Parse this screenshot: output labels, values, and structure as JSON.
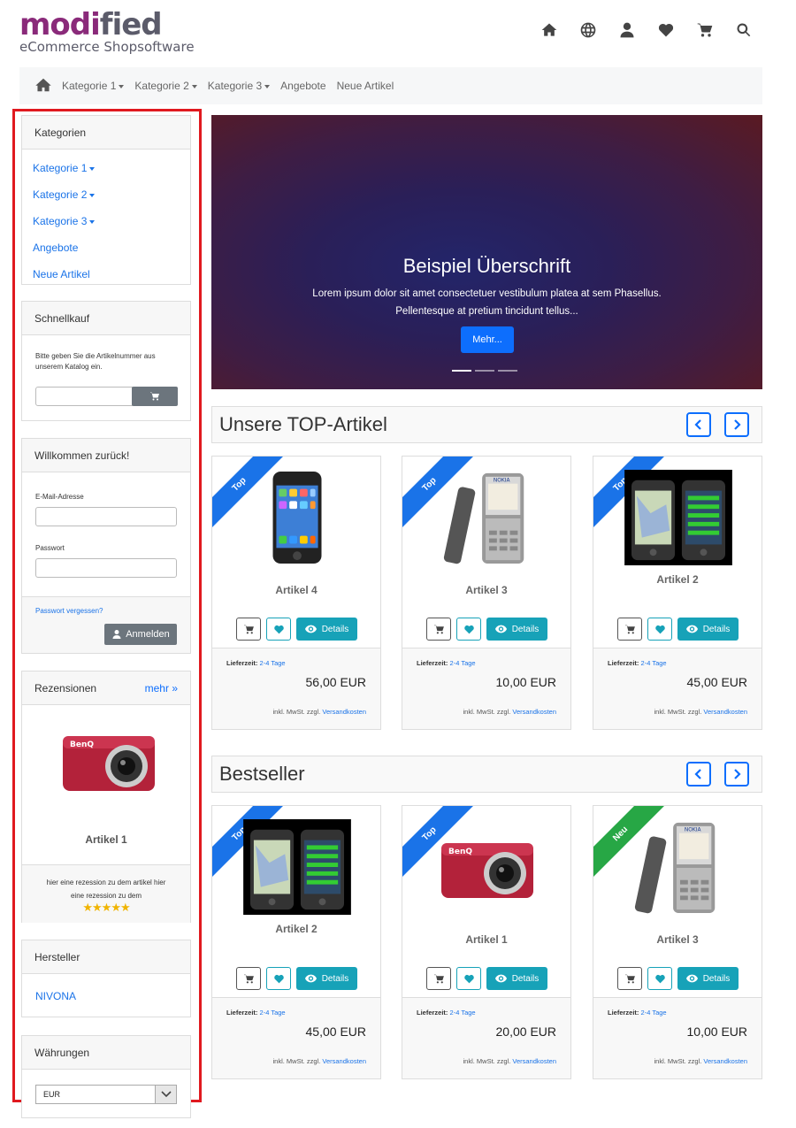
{
  "header": {
    "logo_main_1": "modi",
    "logo_main_2": "fied",
    "logo_sub": "eCommerce Shopsoftware",
    "icons": [
      "home-icon",
      "globe-icon",
      "user-icon",
      "heart-icon",
      "cart-icon",
      "search-icon"
    ]
  },
  "nav": {
    "items": [
      "Kategorie 1",
      "Kategorie 2",
      "Kategorie 3",
      "Angebote",
      "Neue Artikel"
    ]
  },
  "sidebar": {
    "highlight_color": "#e0191f",
    "categories": {
      "title": "Kategorien",
      "items": [
        "Kategorie 1",
        "Kategorie 2",
        "Kategorie 3",
        "Angebote",
        "Neue Artikel"
      ]
    },
    "quickbuy": {
      "title": "Schnellkauf",
      "text": "Bitte geben Sie die Artikelnummer aus unserem Katalog ein."
    },
    "login": {
      "title": "Willkommen zurück!",
      "email_label": "E-Mail-Adresse",
      "password_label": "Passwort",
      "forgot": "Passwort vergessen?",
      "login_button": "Anmelden"
    },
    "reviews": {
      "title": "Rezensionen",
      "more": "mehr »",
      "product": "Artikel 1",
      "text": "hier eine rezession zu dem artikel hier eine rezession zu dem",
      "stars": "★★★★★"
    },
    "manufacturer": {
      "title": "Hersteller",
      "item": "NIVONA"
    },
    "currency": {
      "title": "Währungen",
      "selected": "EUR"
    }
  },
  "hero": {
    "title": "Beispiel Überschrift",
    "text_line1": "Lorem ipsum dolor sit amet consectetuer vestibulum platea at sem Phasellus.",
    "text_line2": "Pellentesque at pretium tincidunt tellus...",
    "button": "Mehr..."
  },
  "sections": {
    "top": "Unsere TOP-Artikel",
    "bestseller": "Bestseller"
  },
  "common": {
    "details": "Details",
    "delivery_label": "Lieferzeit:",
    "delivery_value": "2-4 Tage",
    "tax_text": "inkl. MwSt. zzgl.",
    "shipping_link": "Versandkosten"
  },
  "top_products": [
    {
      "name": "Artikel 4",
      "price": "56,00 EUR",
      "badge": "Top"
    },
    {
      "name": "Artikel 3",
      "price": "10,00 EUR",
      "badge": "Top"
    },
    {
      "name": "Artikel 2",
      "price": "45,00 EUR",
      "badge": "Top"
    }
  ],
  "bestseller_products": [
    {
      "name": "Artikel 2",
      "price": "45,00 EUR",
      "badge": "Top"
    },
    {
      "name": "Artikel 1",
      "price": "20,00 EUR",
      "badge": "Top"
    },
    {
      "name": "Artikel 3",
      "price": "10,00 EUR",
      "badge": "Neu"
    }
  ]
}
